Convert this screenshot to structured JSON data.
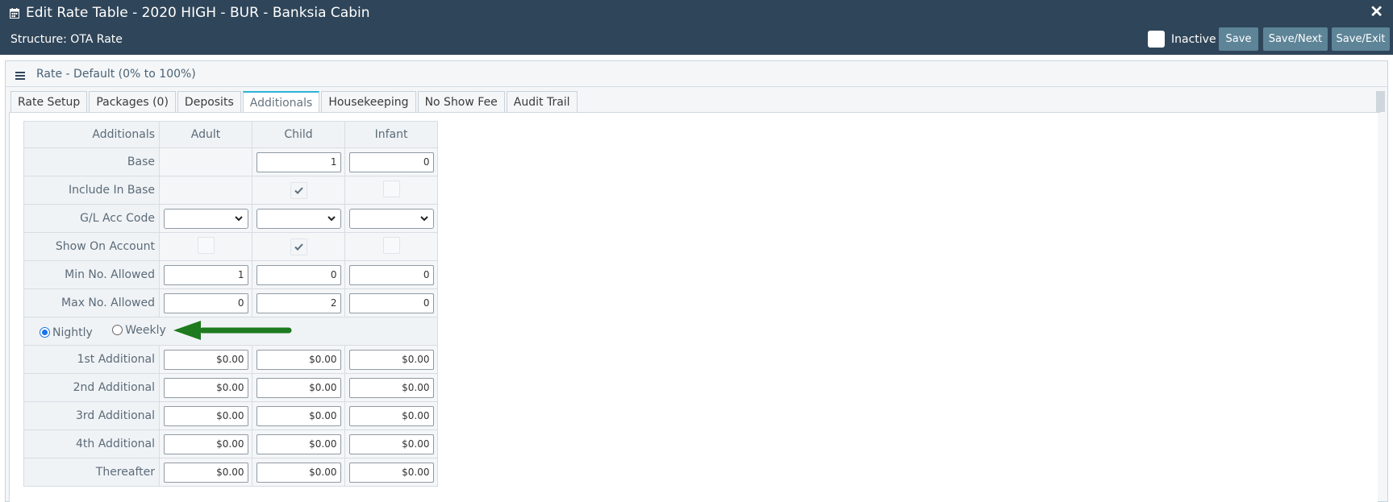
{
  "header": {
    "title": "Edit Rate Table - 2020 HIGH - BUR - Banksia Cabin",
    "close_glyph": "✕",
    "structure": "Structure: OTA Rate",
    "inactive_label": "Inactive",
    "inactive_checked": false,
    "buttons": {
      "save": "Save",
      "save_next": "Save/Next",
      "save_exit": "Save/Exit"
    },
    "bg_color": "#2f4559",
    "button_color": "#5d8497"
  },
  "panel": {
    "title": "Rate - Default (0% to 100%)",
    "tabs": [
      {
        "label": "Rate Setup",
        "active": false
      },
      {
        "label": "Packages (0)",
        "active": false
      },
      {
        "label": "Deposits",
        "active": false
      },
      {
        "label": "Additionals",
        "active": true
      },
      {
        "label": "Housekeeping",
        "active": false
      },
      {
        "label": "No Show Fee",
        "active": false
      },
      {
        "label": "Audit Trail",
        "active": false
      }
    ]
  },
  "table": {
    "columns": [
      "Additionals",
      "Adult",
      "Child",
      "Infant"
    ],
    "base": {
      "label": "Base",
      "adult": "",
      "child": "1",
      "infant": "0"
    },
    "include_in_base": {
      "label": "Include In Base",
      "adult": null,
      "child": true,
      "infant": false
    },
    "gl_acc_code": {
      "label": "G/L Acc Code",
      "adult": "",
      "child": "",
      "infant": ""
    },
    "show_on_account": {
      "label": "Show On Account",
      "adult": false,
      "child": true,
      "infant": false
    },
    "min_allowed": {
      "label": "Min No. Allowed",
      "adult": "1",
      "child": "0",
      "infant": "0"
    },
    "max_allowed": {
      "label": "Max No. Allowed",
      "adult": "0",
      "child": "2",
      "infant": "0"
    },
    "frequency": {
      "nightly": "Nightly",
      "weekly": "Weekly",
      "selected": "Nightly"
    },
    "additional_rows": [
      {
        "label": "1st Additional",
        "adult": "$0.00",
        "child": "$0.00",
        "infant": "$0.00"
      },
      {
        "label": "2nd Additional",
        "adult": "$0.00",
        "child": "$0.00",
        "infant": "$0.00"
      },
      {
        "label": "3rd Additional",
        "adult": "$0.00",
        "child": "$0.00",
        "infant": "$0.00"
      },
      {
        "label": "4th Additional",
        "adult": "$0.00",
        "child": "$0.00",
        "infant": "$0.00"
      },
      {
        "label": "Thereafter",
        "adult": "$0.00",
        "child": "$0.00",
        "infant": "$0.00"
      }
    ],
    "arrow_color": "#1e7a1e"
  }
}
